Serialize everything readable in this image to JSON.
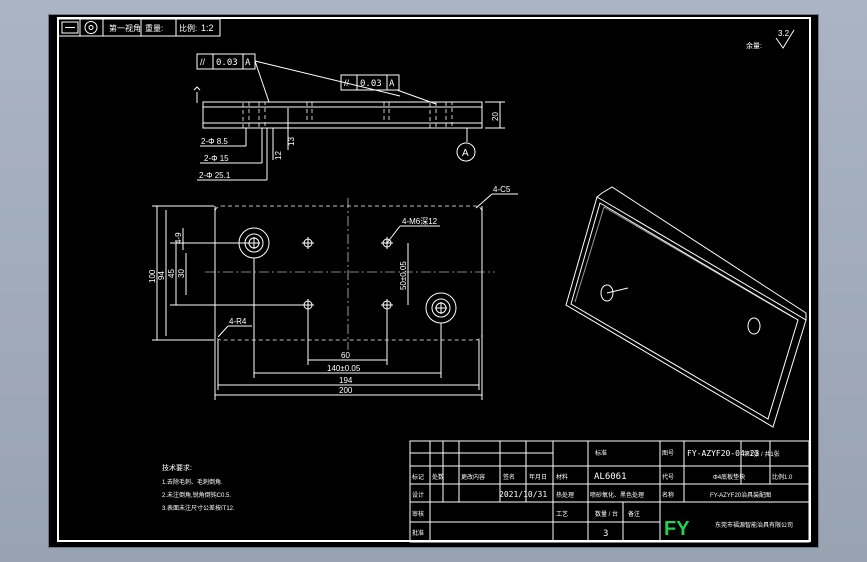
{
  "header_bar": {
    "text1": "第一视角",
    "text2": "重量:",
    "text3": "比例:",
    "scale_value": "1:2"
  },
  "roughness": {
    "label": "余量:",
    "value": "3.2"
  },
  "tolerances": {
    "tol1_value": "0.03",
    "tol1_datum": "A",
    "tol2_value": "0.03",
    "tol2_datum": "A",
    "datum_label": "A"
  },
  "side_view_dims": {
    "d1": "2-Φ 8.5",
    "d2": "2-Φ 15",
    "d3": "2-Φ 25.1",
    "h12": "12",
    "h13": "13",
    "h20": "20"
  },
  "top_view_dims": {
    "chamfer": "4-C5",
    "thread": "4-M6深12",
    "radius": "4-R4",
    "v100": "100",
    "v94": "94",
    "v45": "45",
    "v30": "30",
    "v4": "4-9",
    "v50": "50±0.05",
    "h60": "60",
    "h140": "140±0.05",
    "h194": "194",
    "h200": "200"
  },
  "tech_notes": {
    "title": "技术要求:",
    "lines": [
      "1.去除毛刺、毛刺倒角.",
      "2.未注倒角,锐角倒钝C0.5.",
      "3.表面未注尺寸公差按IT12."
    ]
  },
  "title_block": {
    "drawing_no": "FY-AZYF20-04-23",
    "title_label": "图号",
    "series": "第1张 / 共1张",
    "part_name": "Φ4底板垫块",
    "ratio_label": "比例1.0",
    "material": "AL6061",
    "material_label": "材料",
    "project": "FY-AZYF20治具装配图",
    "project_label": "名称",
    "date": "2021/10/31",
    "quantity": "3",
    "quantity_label": "数量 / 台",
    "surface": "喷砂氧化、黑色处理",
    "company_logo": "FY",
    "company_name": "东莞市福源智能治具有限公司",
    "row_labels": {
      "mark": "标记",
      "count": "处数",
      "change": "更改内容",
      "sign": "签名",
      "date": "年月日",
      "design": "设计",
      "check": "审核",
      "approve": "批准",
      "process": "工艺",
      "code": "代号",
      "standard": "标准",
      "spare": "备注",
      "heat": "热处理",
      "scale": "比例"
    }
  }
}
